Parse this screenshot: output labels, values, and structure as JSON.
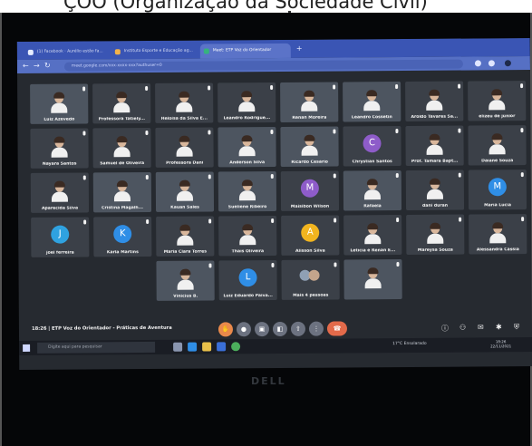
{
  "caption": "ÇÕÕ (Organização da Sociedade Civil)",
  "browser": {
    "tabs": [
      {
        "label": "(1) Facebook · Aurélio estão fa..."
      },
      {
        "label": "Instituto Esporte e Educação ag..."
      },
      {
        "label": "Meet: ETP Voz do Orientador"
      }
    ],
    "url": "meet.google.com/xxx-xxxx-xxx?authuser=0"
  },
  "participants": [
    {
      "name": "Luiz Azevedo",
      "kind": "video"
    },
    {
      "name": "Professora Tatiely...",
      "kind": "person"
    },
    {
      "name": "Heloísa da Silva E...",
      "kind": "person"
    },
    {
      "name": "Leandro Rodrigue...",
      "kind": "person"
    },
    {
      "name": "Renan Moreira",
      "kind": "video"
    },
    {
      "name": "Leandro Cossetin",
      "kind": "video"
    },
    {
      "name": "Aroldo Tavares Sa...",
      "kind": "person"
    },
    {
      "name": "elizeu de júnior",
      "kind": "person"
    },
    {
      "name": "Nayara Santos",
      "kind": "person"
    },
    {
      "name": "Samuel de Oliveira",
      "kind": "person"
    },
    {
      "name": "Professora Dani",
      "kind": "person"
    },
    {
      "name": "Anderson Silva",
      "kind": "video"
    },
    {
      "name": "Ricardo Cesário",
      "kind": "video"
    },
    {
      "name": "Chrystian Santos",
      "kind": "avatar",
      "letter": "C",
      "color": "#8e5cc9"
    },
    {
      "name": "Prof. Tamara Bapt...",
      "kind": "person"
    },
    {
      "name": "Daiane Souza",
      "kind": "person"
    },
    {
      "name": "Aparecida Silva",
      "kind": "person"
    },
    {
      "name": "Cristina Magalh...",
      "kind": "video"
    },
    {
      "name": "Kauan Sales",
      "kind": "video"
    },
    {
      "name": "Sueliene Ribeiro",
      "kind": "video"
    },
    {
      "name": "Maisibon Wilson",
      "kind": "avatar",
      "letter": "M",
      "color": "#8e5cc9"
    },
    {
      "name": "Rafaela",
      "kind": "video"
    },
    {
      "name": "dani duran",
      "kind": "person"
    },
    {
      "name": "Maria Lucia",
      "kind": "avatar",
      "letter": "M",
      "color": "#2f8ee6"
    },
    {
      "name": "joel ferreira",
      "kind": "avatar",
      "letter": "J",
      "color": "#2fa2e0"
    },
    {
      "name": "Karla Martins",
      "kind": "avatar",
      "letter": "K",
      "color": "#2f8ee6"
    },
    {
      "name": "Maria Clara Torres",
      "kind": "person"
    },
    {
      "name": "Thaís Oliveira",
      "kind": "person"
    },
    {
      "name": "Alisson Silva",
      "kind": "avatar",
      "letter": "A",
      "color": "#f2b51f"
    },
    {
      "name": "Letícia e Renan E...",
      "kind": "person"
    },
    {
      "name": "Mareysa Souza",
      "kind": "person"
    },
    {
      "name": "Alessandra Cássia",
      "kind": "person"
    },
    {
      "name": "Vinicius B.",
      "kind": "video"
    },
    {
      "name": "Luiz Eduardo Paiva...",
      "kind": "avatar",
      "letter": "L",
      "color": "#2f8ee6"
    },
    {
      "name": "Mais 4 pessoas",
      "kind": "more"
    },
    {
      "name": "",
      "kind": "video"
    }
  ],
  "meeting": {
    "time": "18:26",
    "title": "ETP Voz do Orientador - Práticas de Aventura"
  },
  "taskbar": {
    "search_placeholder": "Digite aqui para pesquisar",
    "weather": "17°C  Ensolarado",
    "lang": "POR PTB2",
    "clock": "18:26",
    "date": "22/11/2021"
  },
  "laptop_brand": "DELL"
}
